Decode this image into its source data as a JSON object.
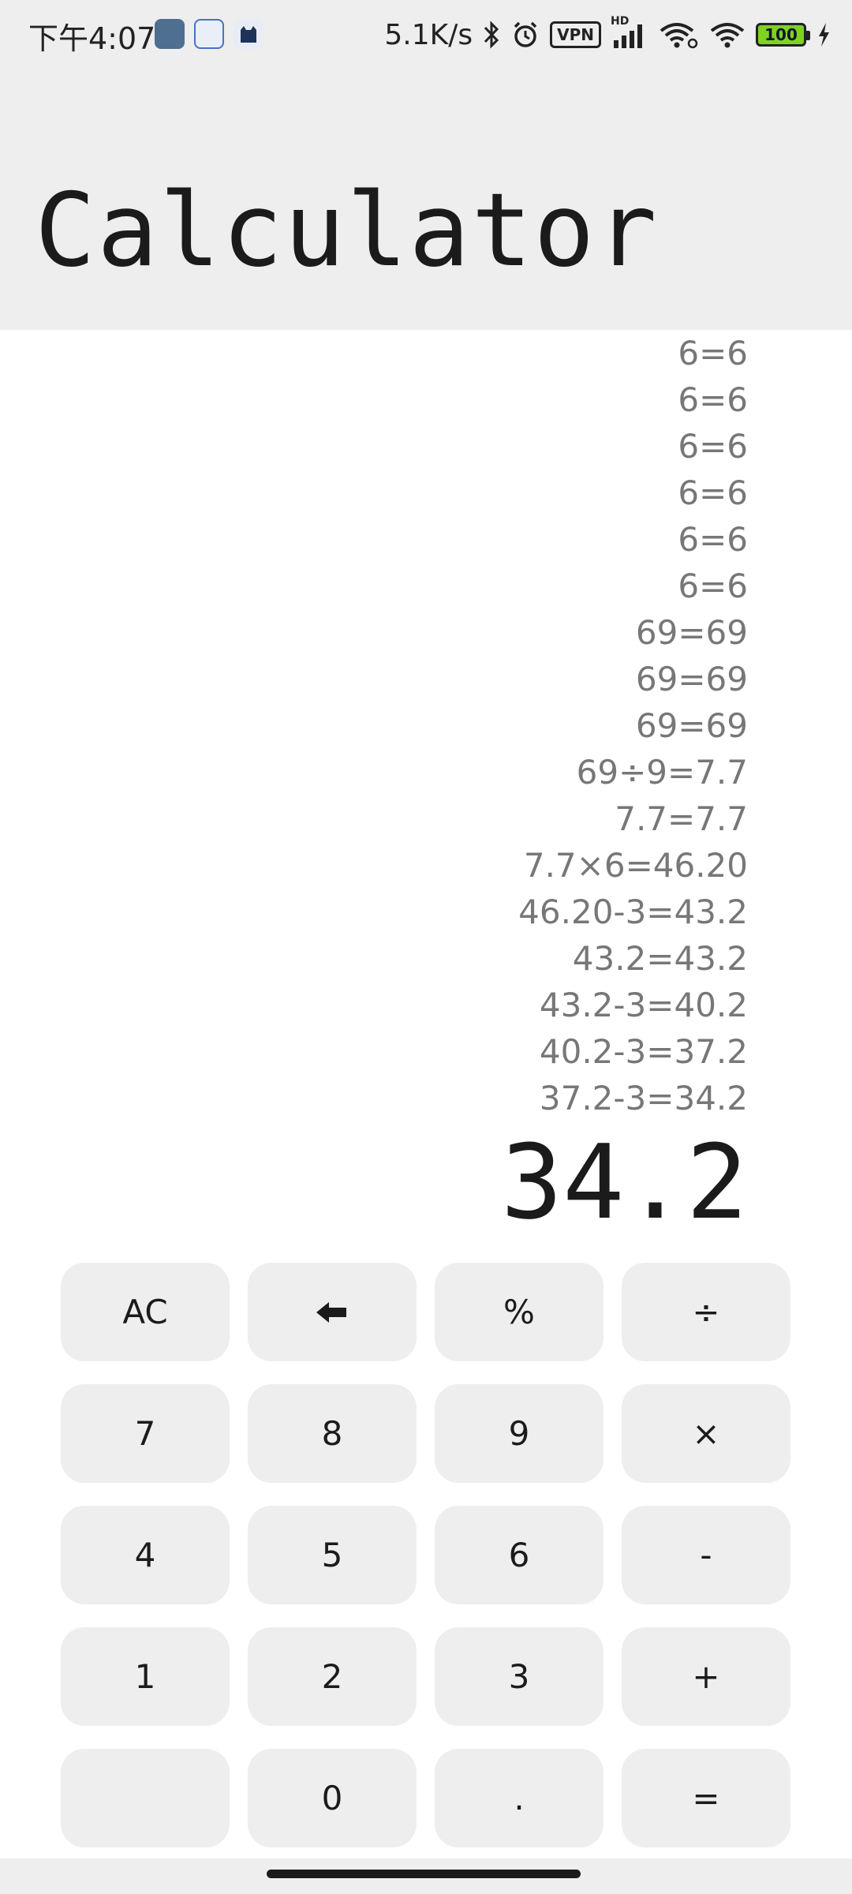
{
  "status_bar": {
    "time": "下午4:07",
    "network_speed": "5.1K/s",
    "vpn_label": "VPN",
    "signal_label": "HD",
    "battery_level": "100"
  },
  "header": {
    "title": "Calculator"
  },
  "history": [
    "6=6",
    "6=6",
    "6=6",
    "6=6",
    "6=6",
    "6=6",
    "69=69",
    "69=69",
    "69=69",
    "69÷9=7.7",
    "7.7=7.7",
    "7.7×6=46.20",
    "46.20-3=43.2",
    "43.2=43.2",
    "43.2-3=40.2",
    "40.2-3=37.2",
    "37.2-3=34.2"
  ],
  "display": {
    "result": "34.2"
  },
  "keypad": {
    "ac": "AC",
    "percent": "%",
    "divide": "÷",
    "seven": "7",
    "eight": "8",
    "nine": "9",
    "multiply": "×",
    "four": "4",
    "five": "5",
    "six": "6",
    "minus": "-",
    "one": "1",
    "two": "2",
    "three": "3",
    "plus": "+",
    "zero": "0",
    "dot": ".",
    "equals": "="
  }
}
